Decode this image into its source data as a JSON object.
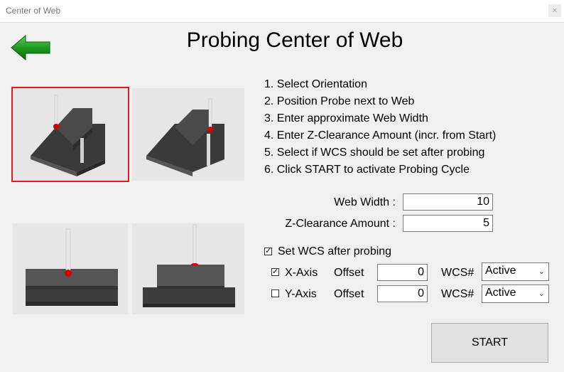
{
  "window": {
    "title": "Center of Web",
    "close_label": "×"
  },
  "header": {
    "title": "Probing Center of Web"
  },
  "steps": [
    "1. Select Orientation",
    "2. Position Probe next to Web",
    "3. Enter approximate Web Width",
    "4. Enter Z-Clearance Amount (incr. from Start)",
    "5. Select if WCS should be set after probing",
    "6. Click START to activate Probing Cycle"
  ],
  "form": {
    "web_width_label": "Web Width :",
    "web_width_value": "10",
    "z_clearance_label": "Z-Clearance Amount :",
    "z_clearance_value": "5",
    "set_wcs_label": "Set WCS after probing",
    "set_wcs_checked": true
  },
  "axes": [
    {
      "label": "X-Axis",
      "checked": true,
      "offset_label": "Offset",
      "offset_value": "0",
      "wcs_label": "WCS#",
      "wcs_value": "Active"
    },
    {
      "label": "Y-Axis",
      "checked": false,
      "offset_label": "Offset",
      "offset_value": "0",
      "wcs_label": "WCS#",
      "wcs_value": "Active"
    }
  ],
  "start_button": "START",
  "colors": {
    "selection_border": "#e01c1c",
    "arrow_green": "#1a8a1a",
    "probe_tip": "#d40000"
  },
  "icons": {
    "back": "left-arrow-icon"
  }
}
